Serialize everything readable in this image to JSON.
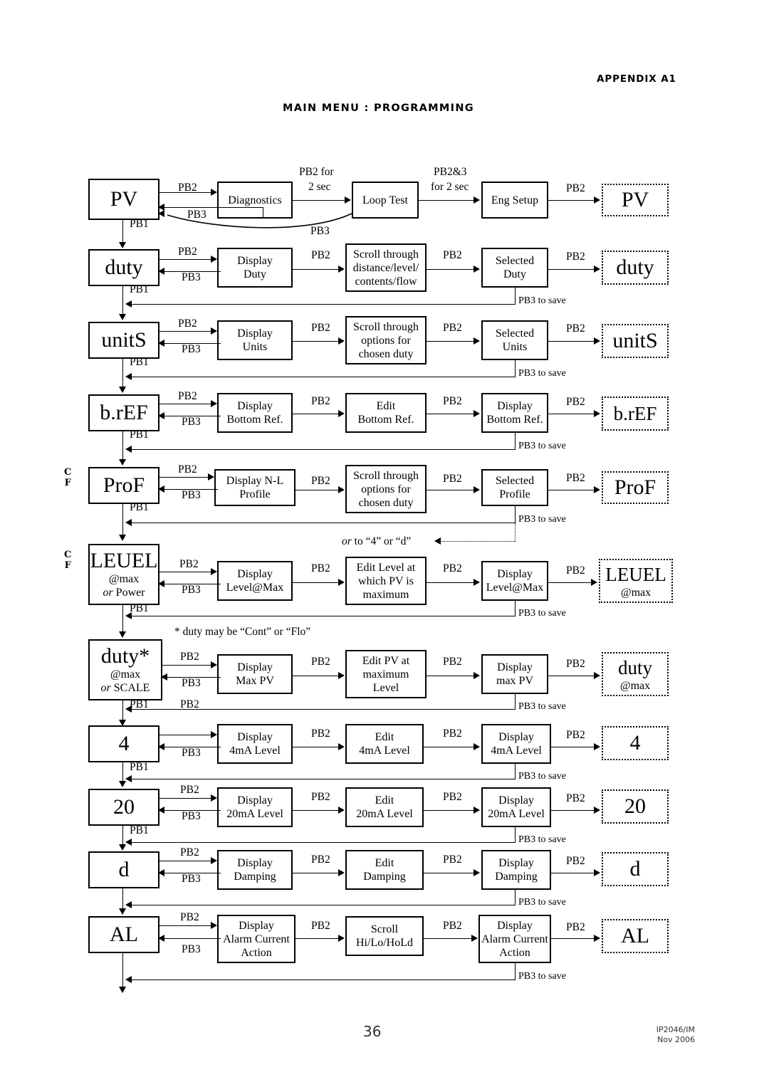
{
  "header": {
    "appendix": "APPENDIX A1",
    "title": "MAIN MENU  :  PROGRAMMING"
  },
  "footer": {
    "page_number": "36",
    "doc_ref": "IP2046/IM",
    "doc_date": "Nov 2006"
  },
  "labels": {
    "pb1": "PB1",
    "pb2": "PB2",
    "pb3": "PB3",
    "pb2_for": "PB2 for",
    "two_sec": "2 sec",
    "pb2and3": "PB2&3",
    "for_two_sec": "for 2 sec",
    "pb3_to_save": "PB3 to save",
    "or_to_4_or_d": "or to “4” or “d”",
    "duty_footnote": "* duty may be “Cont” or “Flo”",
    "cf_c": "C",
    "cf_f": "F"
  },
  "rows": [
    {
      "id": "pv",
      "menu": "PV",
      "menu_sub": "",
      "steps": [
        "Diagnostics",
        "Loop Test",
        "Eng Setup"
      ],
      "result": "PV",
      "result_sub": ""
    },
    {
      "id": "duty",
      "menu": "duty",
      "menu_sub": "",
      "steps": [
        "Display\nDuty",
        "Scroll through\ndistance/level/\ncontents/flow",
        "Selected\nDuty"
      ],
      "result": "duty",
      "result_sub": ""
    },
    {
      "id": "units",
      "menu": "unitS",
      "menu_sub": "",
      "steps": [
        "Display\nUnits",
        "Scroll through\noptions for\nchosen duty",
        "Selected\nUnits"
      ],
      "result": "unitS",
      "result_sub": ""
    },
    {
      "id": "bref",
      "menu": "b.rEF",
      "menu_sub": "",
      "steps": [
        "Display\nBottom Ref.",
        "Edit\nBottom Ref.",
        "Display\nBottom Ref."
      ],
      "result": "b.rEF",
      "result_sub": ""
    },
    {
      "id": "prof",
      "menu": "ProF",
      "menu_sub": "",
      "steps": [
        "Display  N-L\nProfile",
        "Scroll through\noptions for\nchosen duty",
        "Selected\nProfile"
      ],
      "result": "ProF",
      "result_sub": ""
    },
    {
      "id": "leuel",
      "menu": "LEUEL",
      "menu_sub_1": "@max",
      "menu_sub_2_italic": "or",
      "menu_sub_2": "Power",
      "steps": [
        "Display\nLevel@Max",
        "Edit Level at\nwhich PV is\nmaximum",
        "Display\nLevel@Max"
      ],
      "result": "LEUEL",
      "result_sub": "@max"
    },
    {
      "id": "dutymax",
      "menu": "duty*",
      "menu_sub_1": "@max",
      "menu_sub_2_italic": "or",
      "menu_sub_2": "SCALE",
      "steps": [
        "Display\nMax PV",
        "Edit PV at\nmaximum\nLevel",
        "Display\nmax PV"
      ],
      "result": "duty",
      "result_sub": "@max"
    },
    {
      "id": "ma4",
      "menu": "4",
      "menu_sub": "",
      "steps": [
        "Display\n4mA Level",
        "Edit\n4mA Level",
        "Display\n4mA Level"
      ],
      "result": "4",
      "result_sub": ""
    },
    {
      "id": "ma20",
      "menu": "20",
      "menu_sub": "",
      "steps": [
        "Display\n20mA Level",
        "Edit\n20mA Level",
        "Display\n20mA Level"
      ],
      "result": "20",
      "result_sub": ""
    },
    {
      "id": "damping",
      "menu": "d",
      "menu_sub": "",
      "steps": [
        "Display\nDamping",
        "Edit\nDamping",
        "Display\nDamping"
      ],
      "result": "d",
      "result_sub": ""
    },
    {
      "id": "alarm",
      "menu": "AL",
      "menu_sub": "",
      "steps": [
        "Display\nAlarm Current\nAction",
        "Scroll\nHi/Lo/HoLd",
        "Display\nAlarm Current\nAction"
      ],
      "result": "AL",
      "result_sub": ""
    }
  ]
}
